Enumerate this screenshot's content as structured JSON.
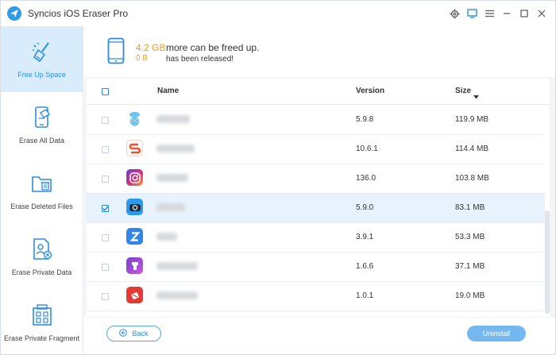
{
  "app": {
    "title": "Syncios iOS Eraser Pro"
  },
  "window_controls": [
    "gear-icon",
    "feedback-icon",
    "menu-icon",
    "minimize-icon",
    "maximize-icon",
    "close-icon"
  ],
  "sidebar": {
    "items": [
      {
        "label": "Free Up Space",
        "icon": "broom-icon",
        "active": true
      },
      {
        "label": "Erase All Data",
        "icon": "phone-erase-icon",
        "active": false
      },
      {
        "label": "Erase Deleted Files",
        "icon": "folder-trash-icon",
        "active": false
      },
      {
        "label": "Erase Private Data",
        "icon": "private-file-icon",
        "active": false
      },
      {
        "label": "Erase Private Fragment",
        "icon": "fragment-icon",
        "active": false
      }
    ]
  },
  "summary": {
    "freeable_size": "4.2 GB",
    "freeable_text": "more can be freed up.",
    "released_size": "0 B",
    "released_text": "has been released!"
  },
  "table": {
    "headers": {
      "name": "Name",
      "version": "Version",
      "size": "Size"
    },
    "rows": [
      {
        "icon": "abo-app-icon",
        "icon_color": "#6fc3ef",
        "version": "5.9.8",
        "size": "119.9 MB",
        "checked": false,
        "name_width": 42
      },
      {
        "icon": "sogou-app-icon",
        "icon_color": "#f0502a",
        "version": "10.6.1",
        "size": "114.4 MB",
        "checked": false,
        "name_width": 48
      },
      {
        "icon": "instagram-app-icon",
        "icon_color": "#d4337a",
        "version": "136.0",
        "size": "103.8 MB",
        "checked": false,
        "name_width": 40
      },
      {
        "icon": "camera-app-icon",
        "icon_color": "#2b9be9",
        "version": "5.9.0",
        "size": "83.1 MB",
        "checked": true,
        "name_width": 36
      },
      {
        "icon": "z-app-icon",
        "icon_color": "#2f86e6",
        "version": "3.9.1",
        "size": "53.3 MB",
        "checked": false,
        "name_width": 26
      },
      {
        "icon": "purple-app-icon",
        "icon_color": "#9a4fd6",
        "version": "1.6.6",
        "size": "37.1 MB",
        "checked": false,
        "name_width": 52
      },
      {
        "icon": "red-app-icon",
        "icon_color": "#e33a35",
        "version": "1.0.1",
        "size": "19.0 MB",
        "checked": false,
        "name_width": 52
      }
    ]
  },
  "footer": {
    "back_label": "Back",
    "uninstall_label": "Uninstall"
  },
  "colors": {
    "accent": "#2d8de0",
    "highlight": "#f39b29",
    "selected_row": "#e7f2fc"
  }
}
